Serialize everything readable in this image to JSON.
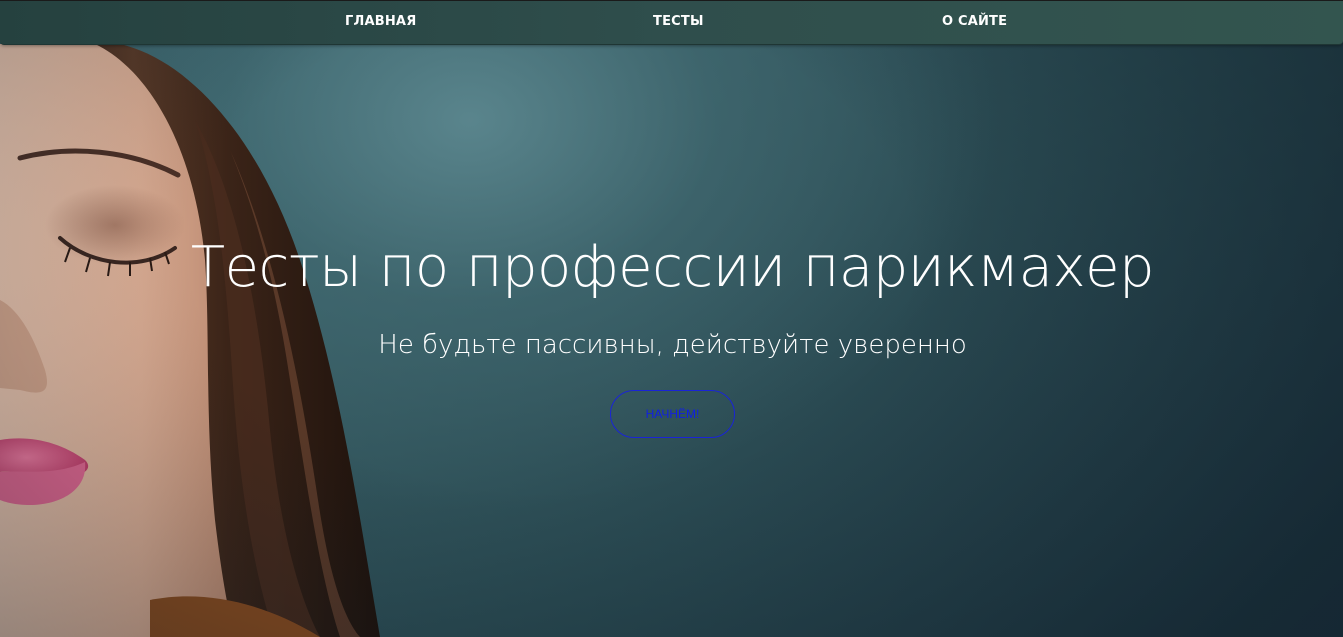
{
  "nav": {
    "items": [
      {
        "label": "ГЛАВНАЯ"
      },
      {
        "label": "ТЕСТЫ"
      },
      {
        "label": "О САЙТЕ"
      }
    ],
    "background": "#2f4e4c",
    "text_color": "#ffffff"
  },
  "hero": {
    "title": "Тесты по профессии парикмахер",
    "subtitle": "Не будьте пассивны, действуйте уверенно",
    "cta_label": "НАЧНЁМ!",
    "background_color": "#34585f",
    "cta_color": "#1a24d6",
    "image": "woman-portrait-photo"
  }
}
